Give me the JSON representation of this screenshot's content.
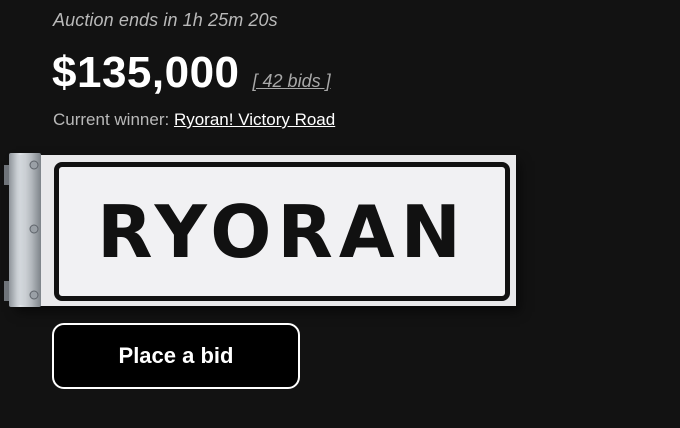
{
  "auction": {
    "countdown_text": "Auction ends in 1h 25m 20s",
    "price": "$135,000",
    "bids_text": "[ 42 bids ]",
    "winner_label": "Current winner:",
    "winner_name": "Ryoran! Victory Road"
  },
  "sign": {
    "text": "RYORAN"
  },
  "actions": {
    "bid_button_label": "Place a bid"
  },
  "colors": {
    "background": "#121212",
    "primary_text": "#ffffff",
    "secondary_text": "#b9b9b9",
    "sign_face": "#e9e9eb",
    "sign_ink": "#111111"
  }
}
